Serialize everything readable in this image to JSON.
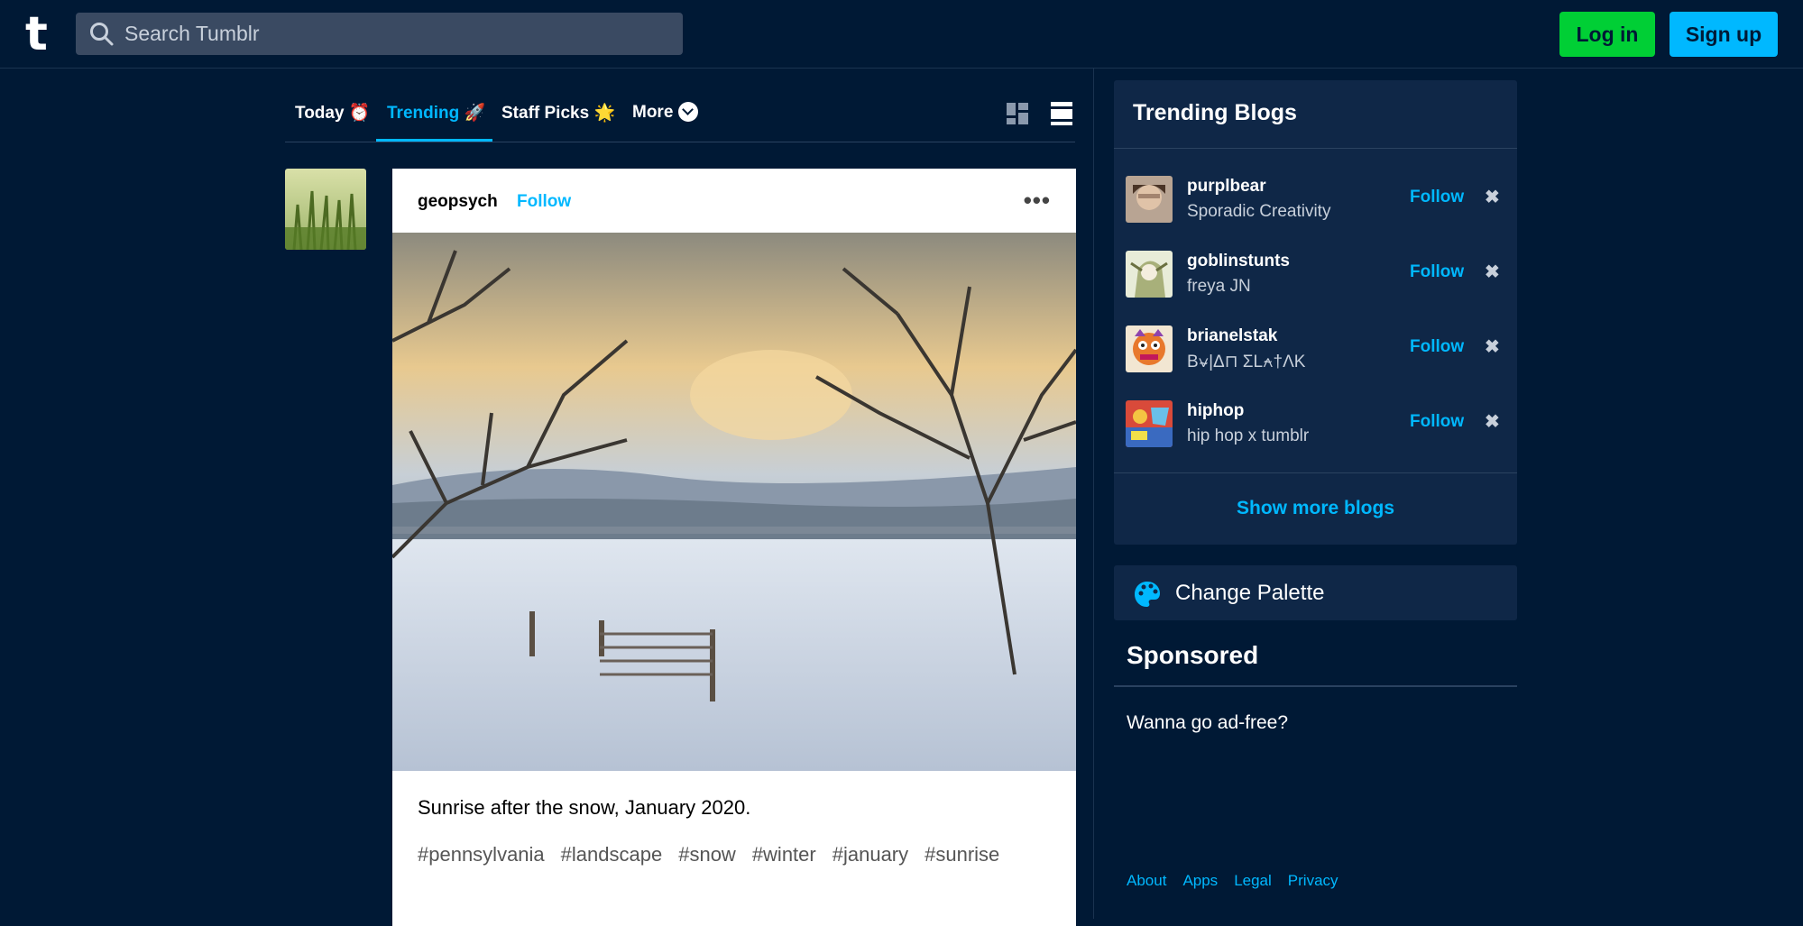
{
  "header": {
    "logo": "t",
    "search_placeholder": "Search Tumblr",
    "login_label": "Log in",
    "signup_label": "Sign up"
  },
  "tabs": {
    "items": [
      {
        "label": "Today",
        "emoji": "⏰"
      },
      {
        "label": "Trending",
        "emoji": "🚀"
      },
      {
        "label": "Staff Picks",
        "emoji": "🌟"
      },
      {
        "label": "More"
      }
    ],
    "active": "Trending"
  },
  "post": {
    "username": "geopsych",
    "follow_label": "Follow",
    "menu_icon": "more-dots-icon",
    "caption": "Sunrise after the snow, January 2020.",
    "tags": [
      "#pennsylvania",
      "#landscape",
      "#snow",
      "#winter",
      "#january",
      "#sunrise"
    ]
  },
  "trending_blogs": {
    "title": "Trending Blogs",
    "blogs": [
      {
        "name": "purplbear",
        "title": "Sporadic Creativity",
        "follow": "Follow"
      },
      {
        "name": "goblinstunts",
        "title": "freya JN",
        "follow": "Follow"
      },
      {
        "name": "brianelstak",
        "title": "B⍱|Δ⊓ ΣL⍲†ΛK",
        "follow": "Follow"
      },
      {
        "name": "hiphop",
        "title": "hip hop x tumblr",
        "follow": "Follow"
      }
    ],
    "show_more": "Show more blogs"
  },
  "palette": {
    "label": "Change Palette"
  },
  "sponsored": {
    "title": "Sponsored",
    "text": "Wanna go ad-free?"
  },
  "footer": {
    "links": [
      "About",
      "Apps",
      "Legal",
      "Privacy"
    ]
  },
  "colors": {
    "background": "#001935",
    "accent": "#00b8ff",
    "login": "#00cf35"
  }
}
